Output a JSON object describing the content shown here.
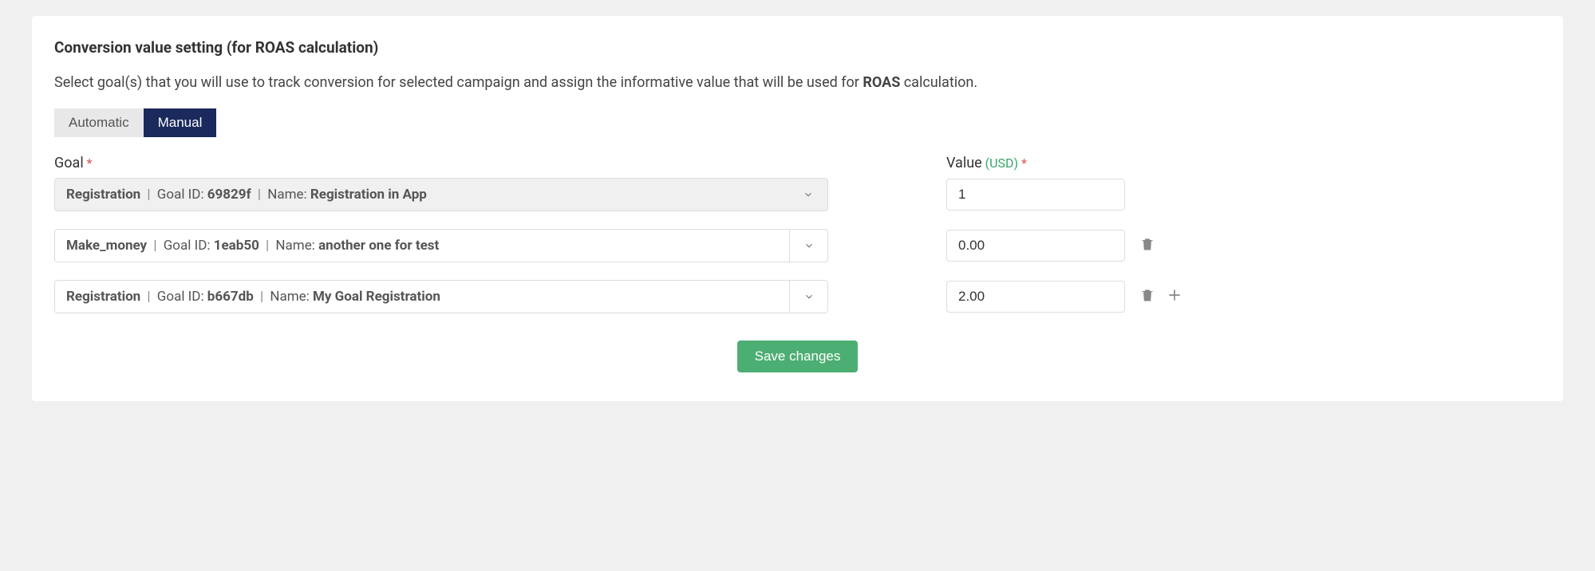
{
  "section": {
    "title": "Conversion value setting (for ROAS calculation)",
    "description_pre": "Select goal(s) that you will use to track conversion for selected campaign and assign the informative value that will be used for ",
    "description_bold": "ROAS",
    "description_post": " calculation."
  },
  "tabs": {
    "automatic": "Automatic",
    "manual": "Manual"
  },
  "labels": {
    "goal": "Goal",
    "value": "Value",
    "usd": "(USD)",
    "asterisk": "*"
  },
  "rows": [
    {
      "disabled": true,
      "goal_type": "Registration",
      "goal_id_label": "Goal ID:",
      "goal_id": "69829f",
      "name_label": "Name:",
      "name": "Registration in App",
      "value": "1",
      "chev_bordered": false,
      "show_delete": false,
      "show_add": false
    },
    {
      "disabled": false,
      "goal_type": "Make_money",
      "goal_id_label": "Goal ID:",
      "goal_id": "1eab50",
      "name_label": "Name:",
      "name": "another one for test",
      "value": "0.00",
      "chev_bordered": true,
      "show_delete": true,
      "show_add": false
    },
    {
      "disabled": false,
      "goal_type": "Registration",
      "goal_id_label": "Goal ID:",
      "goal_id": "b667db",
      "name_label": "Name:",
      "name": "My Goal Registration",
      "value": "2.00",
      "chev_bordered": true,
      "show_delete": true,
      "show_add": true
    }
  ],
  "buttons": {
    "save": "Save changes"
  }
}
